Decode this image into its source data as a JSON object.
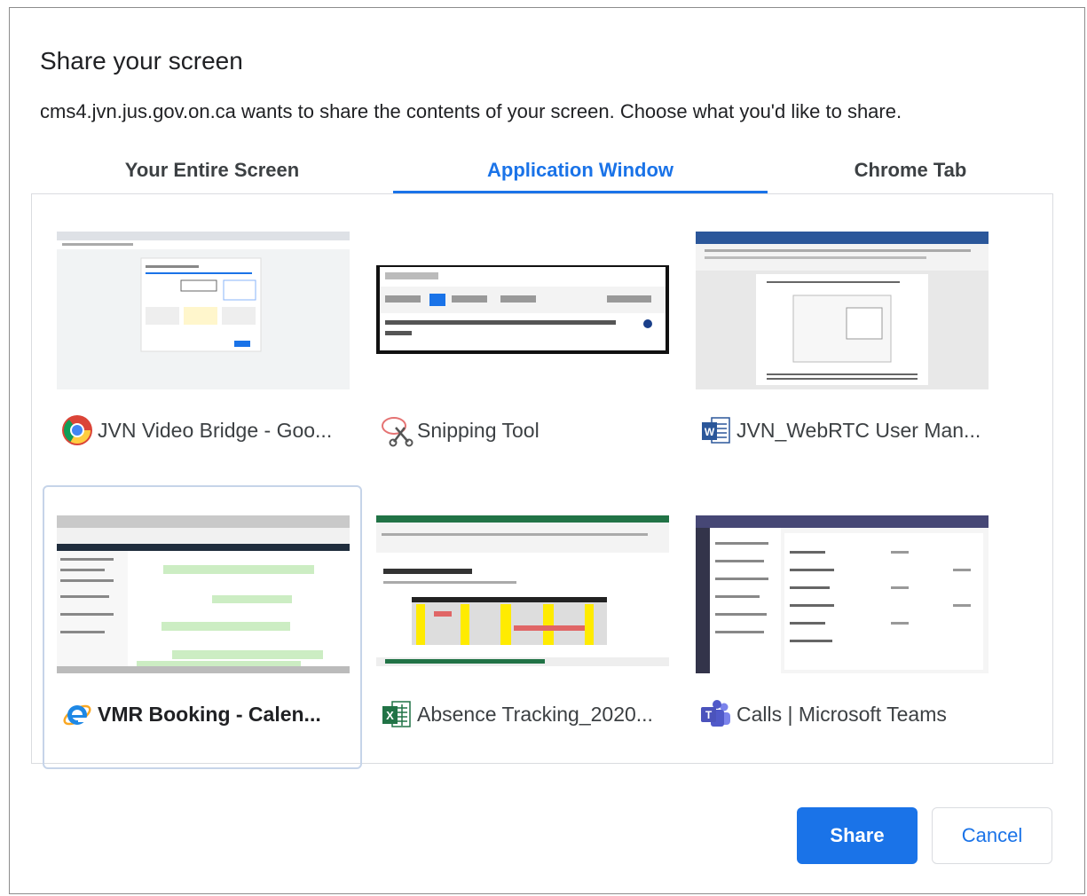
{
  "dialog": {
    "title": "Share your screen",
    "subtitle": "cms4.jvn.jus.gov.on.ca wants to share the contents of your screen. Choose what you'd like to share."
  },
  "tabs": [
    {
      "label": "Your Entire Screen",
      "active": false
    },
    {
      "label": "Application Window",
      "active": true
    },
    {
      "label": "Chrome Tab",
      "active": false
    }
  ],
  "windows": [
    {
      "label": "JVN Video Bridge - Goo...",
      "icon": "chrome-icon",
      "selected": false
    },
    {
      "label": "Snipping Tool",
      "icon": "snipping-tool-icon",
      "selected": false
    },
    {
      "label": "JVN_WebRTC User Man...",
      "icon": "word-icon",
      "selected": false
    },
    {
      "label": "VMR Booking - Calen...",
      "icon": "internet-explorer-icon",
      "selected": true
    },
    {
      "label": "Absence Tracking_2020...",
      "icon": "excel-icon",
      "selected": false
    },
    {
      "label": "Calls | Microsoft Teams",
      "icon": "teams-icon",
      "selected": false
    }
  ],
  "buttons": {
    "share": "Share",
    "cancel": "Cancel"
  },
  "colors": {
    "accent": "#1a73e8",
    "selected_border": "#c6d4e9"
  }
}
